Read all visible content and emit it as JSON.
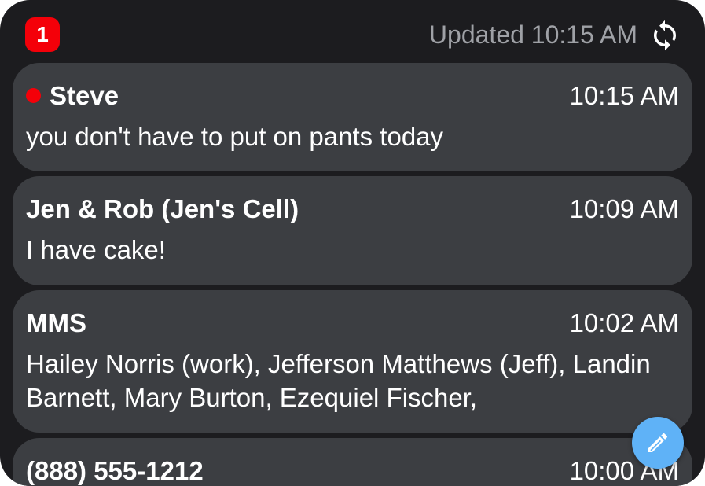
{
  "header": {
    "unread_count": "1",
    "updated_text": "Updated 10:15 AM",
    "refresh_icon": "refresh-icon"
  },
  "conversations": [
    {
      "name": "Steve",
      "time": "10:15 AM",
      "message": "you don't have to put on pants today",
      "unread": true
    },
    {
      "name": "Jen & Rob (Jen's Cell)",
      "time": "10:09 AM",
      "message": "I have cake!",
      "unread": false
    },
    {
      "name": "MMS",
      "time": "10:02 AM",
      "message": "Hailey Norris (work), Jefferson Matthews (Jeff), Landin Barnett, Mary Burton, Ezequiel Fischer,",
      "unread": false
    },
    {
      "name": "(888) 555-1212",
      "time": "10:00 AM",
      "message": "",
      "unread": false
    }
  ],
  "compose": {
    "icon": "pencil-icon"
  },
  "colors": {
    "background": "#1c1c1f",
    "card": "#3c3e42",
    "unread_accent": "#f40009",
    "fab": "#5fb2f7",
    "muted_text": "#9fa1a6"
  }
}
